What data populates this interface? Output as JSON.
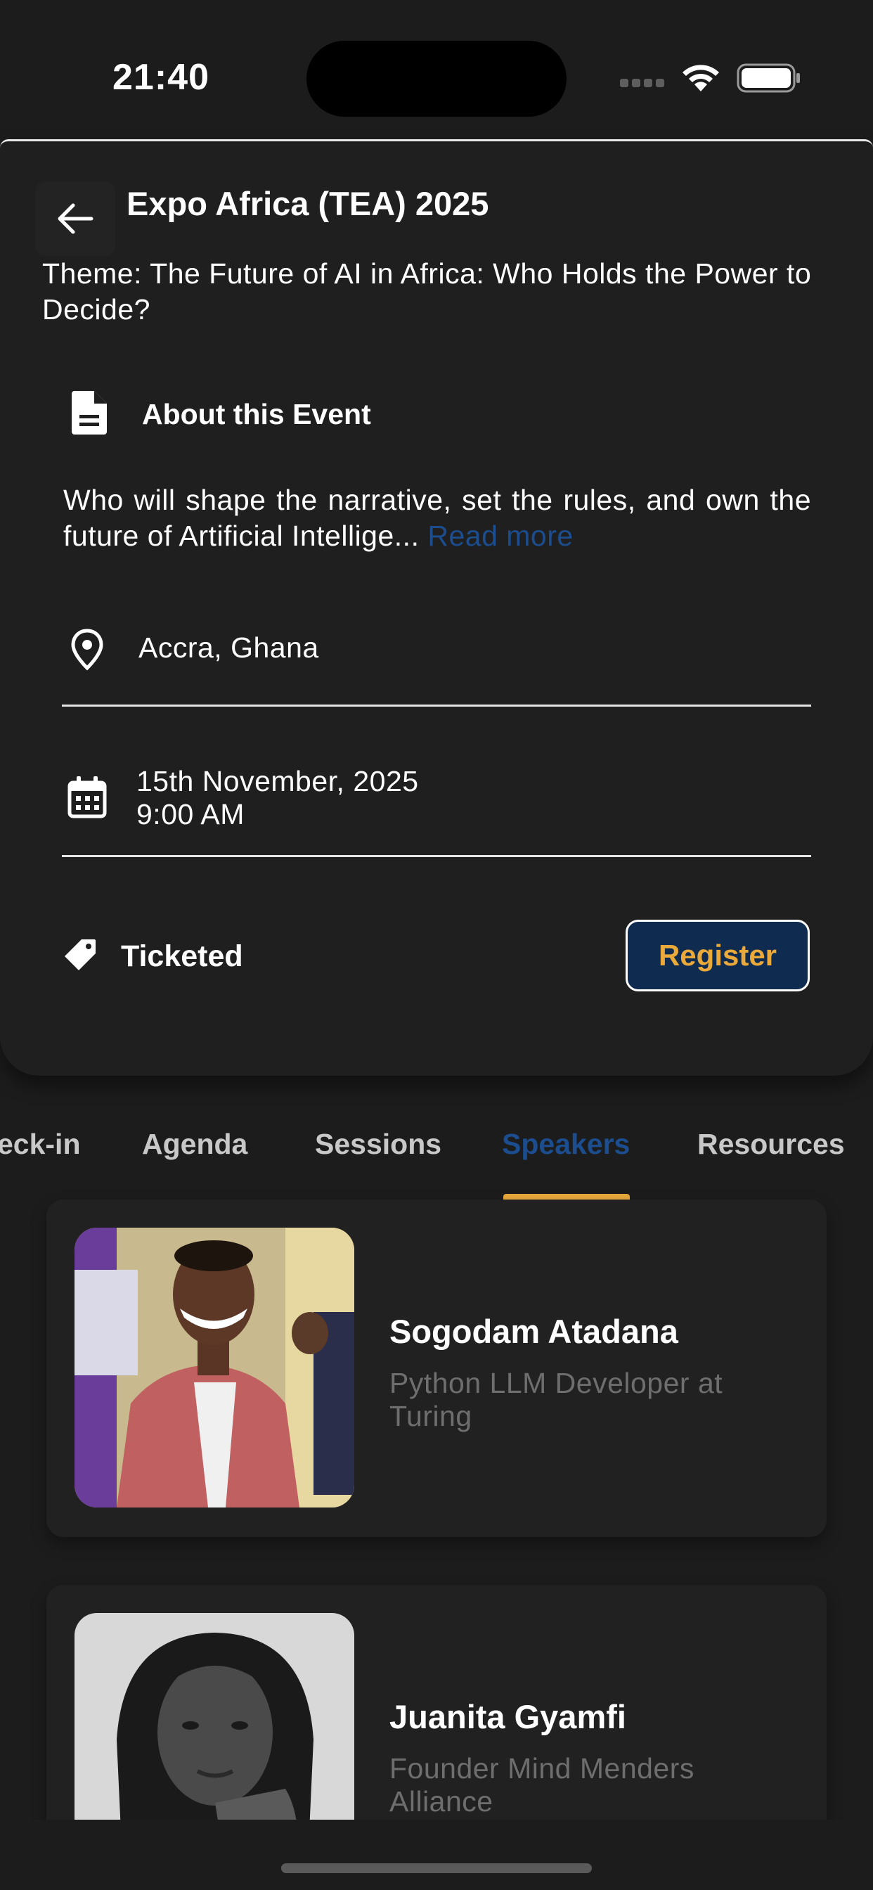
{
  "status_bar": {
    "time": "21:40"
  },
  "header": {
    "title": "Expo Africa (TEA) 2025"
  },
  "theme": "Theme: The Future of AI in Africa: Who Holds the Power to Decide?",
  "about": {
    "heading": "About this Event",
    "text": "Who will shape the narrative, set the rules, and own the future of Artificial Intellige...",
    "read_more": "Read more"
  },
  "location": "Accra, Ghana",
  "schedule": {
    "date": "15th November, 2025",
    "time": "9:00 AM"
  },
  "ticket": {
    "label": "Ticketed",
    "register_label": "Register"
  },
  "tabs": [
    {
      "label": "eck-in"
    },
    {
      "label": "Agenda"
    },
    {
      "label": "Sessions"
    },
    {
      "label": "Speakers",
      "active": true
    },
    {
      "label": "Resources"
    }
  ],
  "speakers": [
    {
      "name": "Sogodam Atadana",
      "role": "Python LLM Developer at Turing"
    },
    {
      "name": "Juanita Gyamfi",
      "role": "Founder Mind Menders Alliance"
    }
  ],
  "colors": {
    "background": "#1c1c1c",
    "accent": "#e9a93b",
    "link": "#1b4d8f",
    "button_bg": "#0f2b4f"
  },
  "icons": [
    "arrow-left-icon",
    "document-icon",
    "location-pin-icon",
    "calendar-icon",
    "tag-icon",
    "wifi-icon",
    "battery-icon"
  ]
}
